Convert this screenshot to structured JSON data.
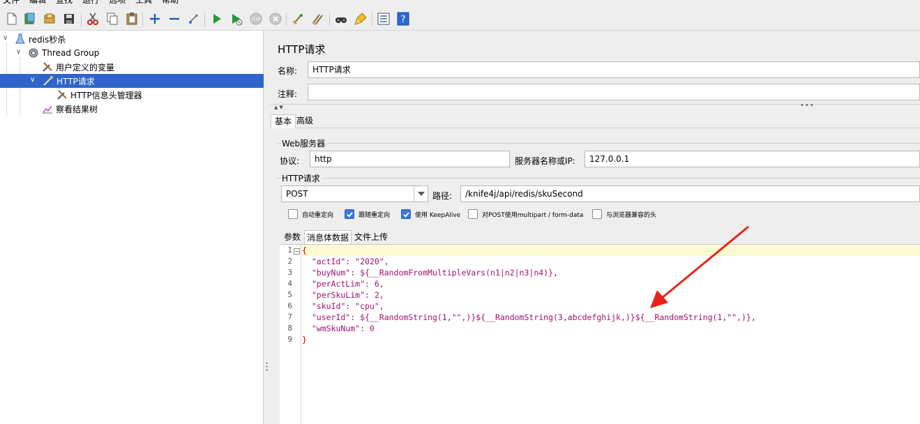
{
  "menu": [
    "文件",
    "编辑",
    "查找",
    "运行",
    "选项",
    "工具",
    "帮助"
  ],
  "toolbar": {
    "icons": [
      "new-icon",
      "templates-icon",
      "open-icon",
      "save-icon",
      "cut-icon",
      "copy-icon",
      "paste-icon",
      "expand-icon",
      "collapse-icon",
      "toggle-icon",
      "start-icon",
      "start-no-pause-icon",
      "stop-icon",
      "shutdown-icon",
      "clear-icon",
      "clear-all-icon",
      "search-icon",
      "reset-search-icon",
      "function-helper-icon",
      "help-icon"
    ]
  },
  "tree": {
    "items": [
      {
        "label": "redis秒杀",
        "icon": "flask-icon"
      },
      {
        "label": "Thread Group",
        "icon": "gear-icon"
      },
      {
        "label": "用户定义的变量",
        "icon": "wrench-icon"
      },
      {
        "label": "HTTP请求",
        "icon": "pipette-icon",
        "selected": true
      },
      {
        "label": "HTTP信息头管理器",
        "icon": "wrench-icon"
      },
      {
        "label": "察看结果树",
        "icon": "chart-icon"
      }
    ]
  },
  "panel": {
    "title": "HTTP请求",
    "name_label": "名称:",
    "name_value": "HTTP请求",
    "comment_label": "注释:",
    "comment_value": "",
    "tabs": [
      "基本",
      "高级"
    ],
    "web_server": {
      "title": "Web服务器",
      "protocol_label": "协议:",
      "protocol_value": "http",
      "server_label": "服务器名称或IP:",
      "server_value": "127.0.0.1"
    },
    "http_request": {
      "title": "HTTP请求",
      "method": "POST",
      "path_label": "路径:",
      "path_value": "/knife4j/api/redis/skuSecond"
    },
    "checkboxes": [
      {
        "label": "自动重定向",
        "checked": false
      },
      {
        "label": "跟随重定向",
        "checked": true
      },
      {
        "label": "使用 KeepAlive",
        "checked": true
      },
      {
        "label": "对POST使用multipart / form-data",
        "checked": false
      },
      {
        "label": "与浏览器兼容的头",
        "checked": false
      }
    ],
    "subtabs": [
      "参数",
      "消息体数据",
      "文件上传"
    ]
  },
  "editor": {
    "line_numbers": [
      "1",
      "2",
      "3",
      "4",
      "5",
      "6",
      "7",
      "8",
      "9"
    ],
    "lines": [
      "{",
      "  \"actId\": \"2020\",",
      "  \"buyNum\": ${__RandomFromMultipleVars(n1|n2|n3|n4)},",
      "  \"perActLim\": 6,",
      "  \"perSkuLim\": 2,",
      "  \"skuId\": \"cpu\",",
      "  \"userId\": ${__RandomString(1,\"\",)}${__RandomString(3,abcdefghijk,)}${__RandomString(1,\"\",)},",
      "  \"wmSkuNum\": 0",
      "}"
    ]
  },
  "colors": {
    "selection": "#2f65ca",
    "accent_arrow": "#e8231b",
    "current_line": "#fcfad0"
  }
}
